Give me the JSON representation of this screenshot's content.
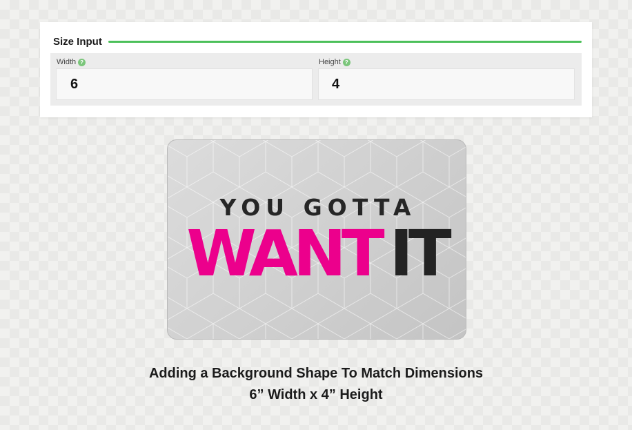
{
  "size_input": {
    "title": "Size Input",
    "width_label": "Width",
    "height_label": "Height",
    "help_symbol": "?",
    "width_value": "6",
    "height_value": "4"
  },
  "preview": {
    "line1": "YOU GOTTA",
    "word_pink": "WANT",
    "word_dark": "IT",
    "pink_color": "#ec008c",
    "dark_color": "#232323"
  },
  "caption": {
    "line1": "Adding a Background Shape To Match Dimensions",
    "line2": "6” Width x 4” Height"
  },
  "colors": {
    "accent_rule": "#4cc05a",
    "help_icon": "#7bc67b"
  }
}
